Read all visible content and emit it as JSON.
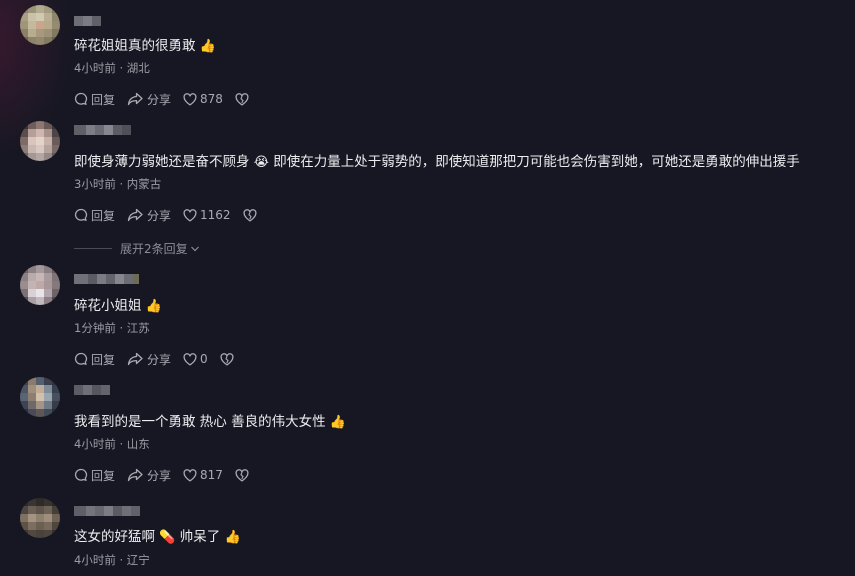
{
  "comments": [
    {
      "text": "碎花姐姐真的很勇敢",
      "emoji": "👍",
      "meta": "4小时前 · 湖北",
      "reply_label": "回复",
      "share_label": "分享",
      "likes": "878"
    },
    {
      "text": "即使身薄力弱她还是奋不顾身",
      "emoji": "😭",
      "text_after": "即使在力量上处于弱势的，即使知道那把刀可能也会伤害到她，可她还是勇敢的伸出援手",
      "meta": "3小时前 · 内蒙古",
      "reply_label": "回复",
      "share_label": "分享",
      "likes": "1162",
      "expand_label": "展开2条回复"
    },
    {
      "text": "碎花小姐姐",
      "emoji": "👍",
      "meta": "1分钟前 · 江苏",
      "reply_label": "回复",
      "share_label": "分享",
      "likes": "0"
    },
    {
      "text": "我看到的是一个勇敢 热心 善良的伟大女性",
      "emoji": "👍",
      "meta": "4小时前 · 山东",
      "reply_label": "回复",
      "share_label": "分享",
      "likes": "817"
    },
    {
      "text": "这女的好猛啊",
      "emoji": "💊",
      "text_after": "帅呆了",
      "emoji2": "👍",
      "meta": "4小时前 · 辽宁"
    }
  ],
  "icons": {
    "reply": "comment-bubble-icon",
    "share": "share-arrow-icon",
    "like": "heart-icon",
    "dislike": "broken-heart-icon",
    "expand": "chevron-down-icon"
  },
  "colors": {
    "background": "#161722",
    "text": "#ededf0",
    "meta": "#9a9ba3"
  }
}
